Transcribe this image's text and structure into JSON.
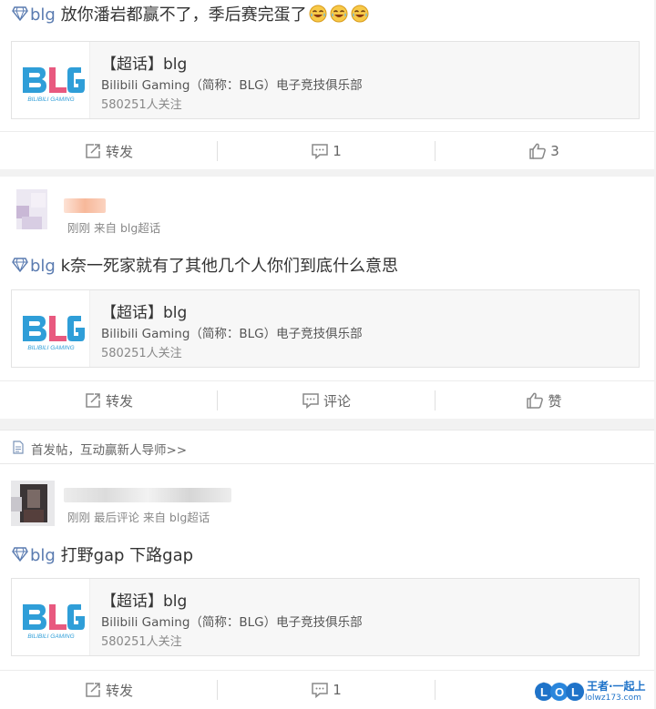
{
  "colors": {
    "tag": "#5a7bb0",
    "blg_blue": "#2f9ed8",
    "blg_pink": "#e8597f",
    "like_icon": "#888888"
  },
  "topic": {
    "title": "【超话】blg",
    "subtitle": "Bilibili Gaming（简称：BLG）电子竞技俱乐部",
    "followers": "580251人关注",
    "logo_text": "BLG",
    "logo_tagline": "BILIBILI GAMING"
  },
  "posts": [
    {
      "tag": "blg",
      "text": " 放你潘岩都赢不了，季后赛完蛋了",
      "emojis": [
        "laugh-cry-emoji",
        "laugh-cry-emoji",
        "laugh-cry-emoji"
      ],
      "actions": {
        "repost": "转发",
        "comment": "1",
        "like": "3"
      }
    },
    {
      "meta": "刚刚 来自 blg超话",
      "tag": "blg",
      "text": " k奈一死家就有了其他几个人你们到底什么意思",
      "actions": {
        "repost": "转发",
        "comment": "评论",
        "like": "赞"
      }
    },
    {
      "meta": "刚刚 最后评论 来自 blg超话",
      "tag": "blg",
      "text": " 打野gap 下路gap",
      "actions": {
        "repost": "转发",
        "comment": "1"
      }
    }
  ],
  "notice": {
    "text": "首发帖，互动赢新人导师>>",
    "icon": "document-icon"
  },
  "watermark": {
    "logo": "iLOL",
    "text": "王者·一起上",
    "url": "lolwz173.com"
  }
}
